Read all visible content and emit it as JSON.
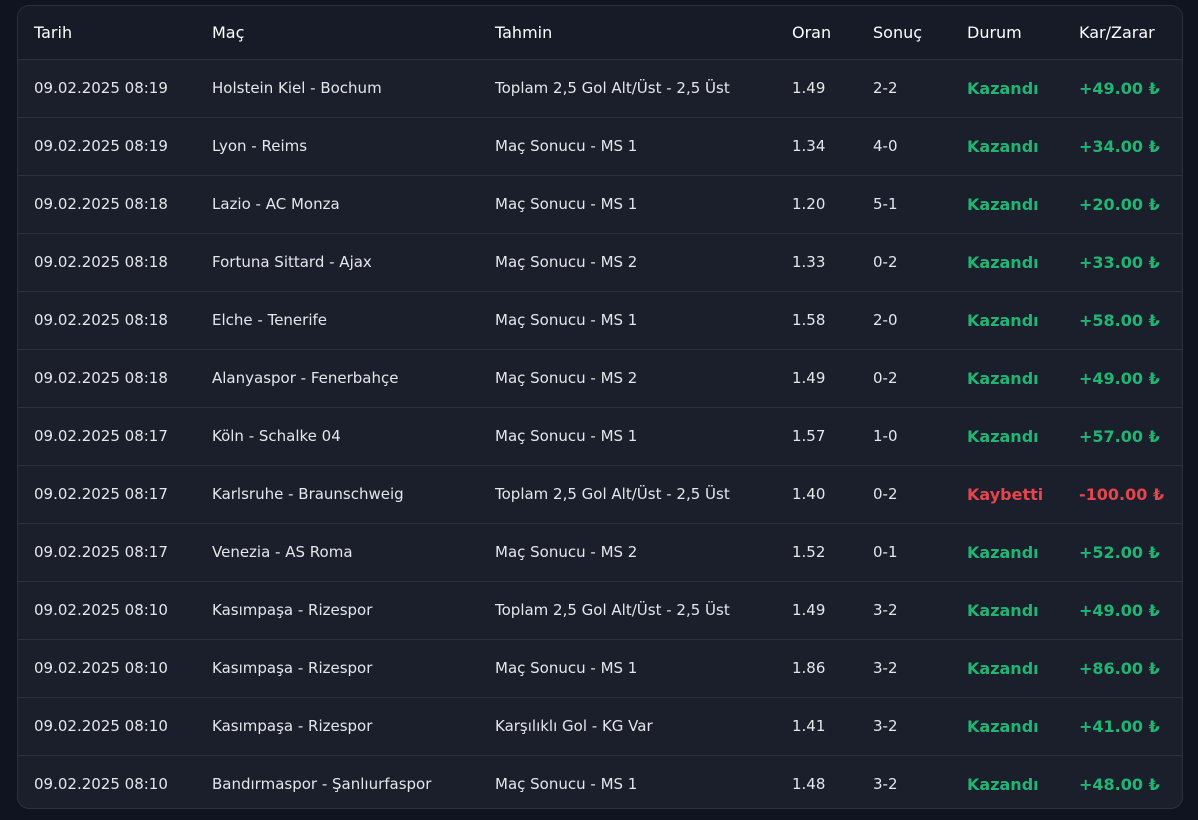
{
  "columns": {
    "date": "Tarih",
    "match": "Maç",
    "prediction": "Tahmin",
    "odds": "Oran",
    "score": "Sonuç",
    "status": "Durum",
    "profit_loss": "Kar/Zarar"
  },
  "colors": {
    "won": "#21b573",
    "lost": "#e5454c"
  },
  "rows": [
    {
      "date": "09.02.2025 08:19",
      "match": "Holstein Kiel - Bochum",
      "prediction": "Toplam 2,5 Gol Alt/Üst - 2,5 Üst",
      "odds": "1.49",
      "score": "2-2",
      "status": "Kazandı",
      "profit_loss": "+49.00 ₺",
      "won": true
    },
    {
      "date": "09.02.2025 08:19",
      "match": "Lyon - Reims",
      "prediction": "Maç Sonucu - MS 1",
      "odds": "1.34",
      "score": "4-0",
      "status": "Kazandı",
      "profit_loss": "+34.00 ₺",
      "won": true
    },
    {
      "date": "09.02.2025 08:18",
      "match": "Lazio - AC Monza",
      "prediction": "Maç Sonucu - MS 1",
      "odds": "1.20",
      "score": "5-1",
      "status": "Kazandı",
      "profit_loss": "+20.00 ₺",
      "won": true
    },
    {
      "date": "09.02.2025 08:18",
      "match": "Fortuna Sittard - Ajax",
      "prediction": "Maç Sonucu - MS 2",
      "odds": "1.33",
      "score": "0-2",
      "status": "Kazandı",
      "profit_loss": "+33.00 ₺",
      "won": true
    },
    {
      "date": "09.02.2025 08:18",
      "match": "Elche - Tenerife",
      "prediction": "Maç Sonucu - MS 1",
      "odds": "1.58",
      "score": "2-0",
      "status": "Kazandı",
      "profit_loss": "+58.00 ₺",
      "won": true
    },
    {
      "date": "09.02.2025 08:18",
      "match": "Alanyaspor - Fenerbahçe",
      "prediction": "Maç Sonucu - MS 2",
      "odds": "1.49",
      "score": "0-2",
      "status": "Kazandı",
      "profit_loss": "+49.00 ₺",
      "won": true
    },
    {
      "date": "09.02.2025 08:17",
      "match": "Köln - Schalke 04",
      "prediction": "Maç Sonucu - MS 1",
      "odds": "1.57",
      "score": "1-0",
      "status": "Kazandı",
      "profit_loss": "+57.00 ₺",
      "won": true
    },
    {
      "date": "09.02.2025 08:17",
      "match": "Karlsruhe - Braunschweig",
      "prediction": "Toplam 2,5 Gol Alt/Üst - 2,5 Üst",
      "odds": "1.40",
      "score": "0-2",
      "status": "Kaybetti",
      "profit_loss": "-100.00 ₺",
      "won": false
    },
    {
      "date": "09.02.2025 08:17",
      "match": "Venezia - AS Roma",
      "prediction": "Maç Sonucu - MS 2",
      "odds": "1.52",
      "score": "0-1",
      "status": "Kazandı",
      "profit_loss": "+52.00 ₺",
      "won": true
    },
    {
      "date": "09.02.2025 08:10",
      "match": "Kasımpaşa - Rizespor",
      "prediction": "Toplam 2,5 Gol Alt/Üst - 2,5 Üst",
      "odds": "1.49",
      "score": "3-2",
      "status": "Kazandı",
      "profit_loss": "+49.00 ₺",
      "won": true
    },
    {
      "date": "09.02.2025 08:10",
      "match": "Kasımpaşa - Rizespor",
      "prediction": "Maç Sonucu - MS 1",
      "odds": "1.86",
      "score": "3-2",
      "status": "Kazandı",
      "profit_loss": "+86.00 ₺",
      "won": true
    },
    {
      "date": "09.02.2025 08:10",
      "match": "Kasımpaşa - Rizespor",
      "prediction": "Karşılıklı Gol - KG Var",
      "odds": "1.41",
      "score": "3-2",
      "status": "Kazandı",
      "profit_loss": "+41.00 ₺",
      "won": true
    },
    {
      "date": "09.02.2025 08:10",
      "match": "Bandırmaspor - Şanlıurfaspor",
      "prediction": "Maç Sonucu - MS 1",
      "odds": "1.48",
      "score": "3-2",
      "status": "Kazandı",
      "profit_loss": "+48.00 ₺",
      "won": true
    }
  ]
}
